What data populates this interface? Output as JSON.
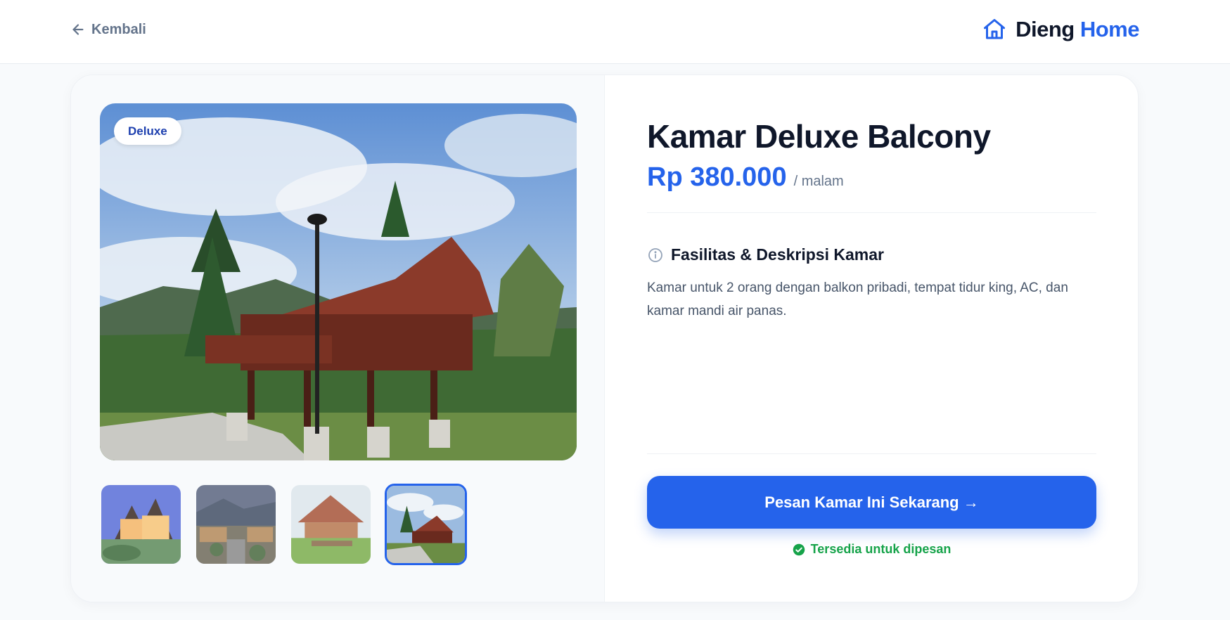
{
  "header": {
    "back_label": "Kembali",
    "logo_part1": "Dieng",
    "logo_part2": "Home"
  },
  "gallery": {
    "badge": "Deluxe",
    "thumbnail_count": 4,
    "active_thumbnail_index": 3
  },
  "room": {
    "title": "Kamar Deluxe Balcony",
    "price": "Rp 380.000",
    "price_unit": "/ malam",
    "section_title": "Fasilitas & Deskripsi Kamar",
    "description": "Kamar untuk 2 orang dengan balkon pribadi, tempat tidur king, AC, dan kamar mandi air panas.",
    "cta_label": "Pesan Kamar Ini Sekarang →",
    "availability": "Tersedia untuk dipesan"
  },
  "colors": {
    "accent": "#2563eb",
    "success": "#16a34a",
    "text_dark": "#0f172a",
    "text_muted": "#64748b"
  },
  "icons": {
    "back": "arrow-left-icon",
    "logo": "house-icon",
    "info": "info-circle-icon",
    "available": "check-circle-icon"
  }
}
